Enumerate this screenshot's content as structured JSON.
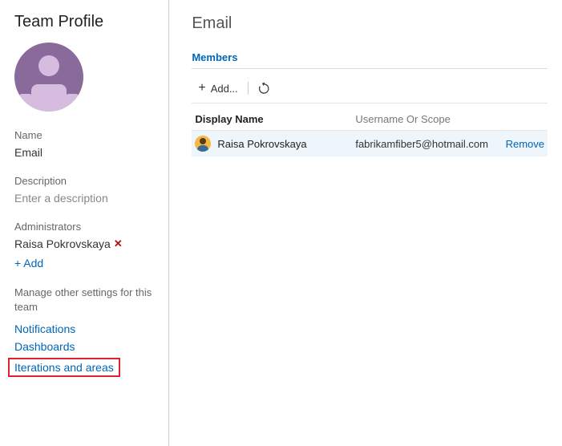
{
  "sidebar": {
    "title": "Team Profile",
    "name_label": "Name",
    "name_value": "Email",
    "description_label": "Description",
    "description_placeholder": "Enter a description",
    "admins_label": "Administrators",
    "admins": [
      {
        "display_name": "Raisa Pokrovskaya"
      }
    ],
    "add_admin_label": "+ Add",
    "manage_label": "Manage other settings for this team",
    "links": [
      {
        "label": "Notifications"
      },
      {
        "label": "Dashboards"
      },
      {
        "label": "Iterations and areas",
        "highlighted": true
      }
    ]
  },
  "main": {
    "title": "Email",
    "tabs": [
      {
        "label": "Members",
        "active": true
      }
    ],
    "toolbar": {
      "add_label": "Add..."
    },
    "columns": {
      "display_name": "Display Name",
      "username": "Username Or Scope"
    },
    "members": [
      {
        "display_name": "Raisa Pokrovskaya",
        "username": "fabrikamfiber5@hotmail.com",
        "action_label": "Remove"
      }
    ]
  }
}
